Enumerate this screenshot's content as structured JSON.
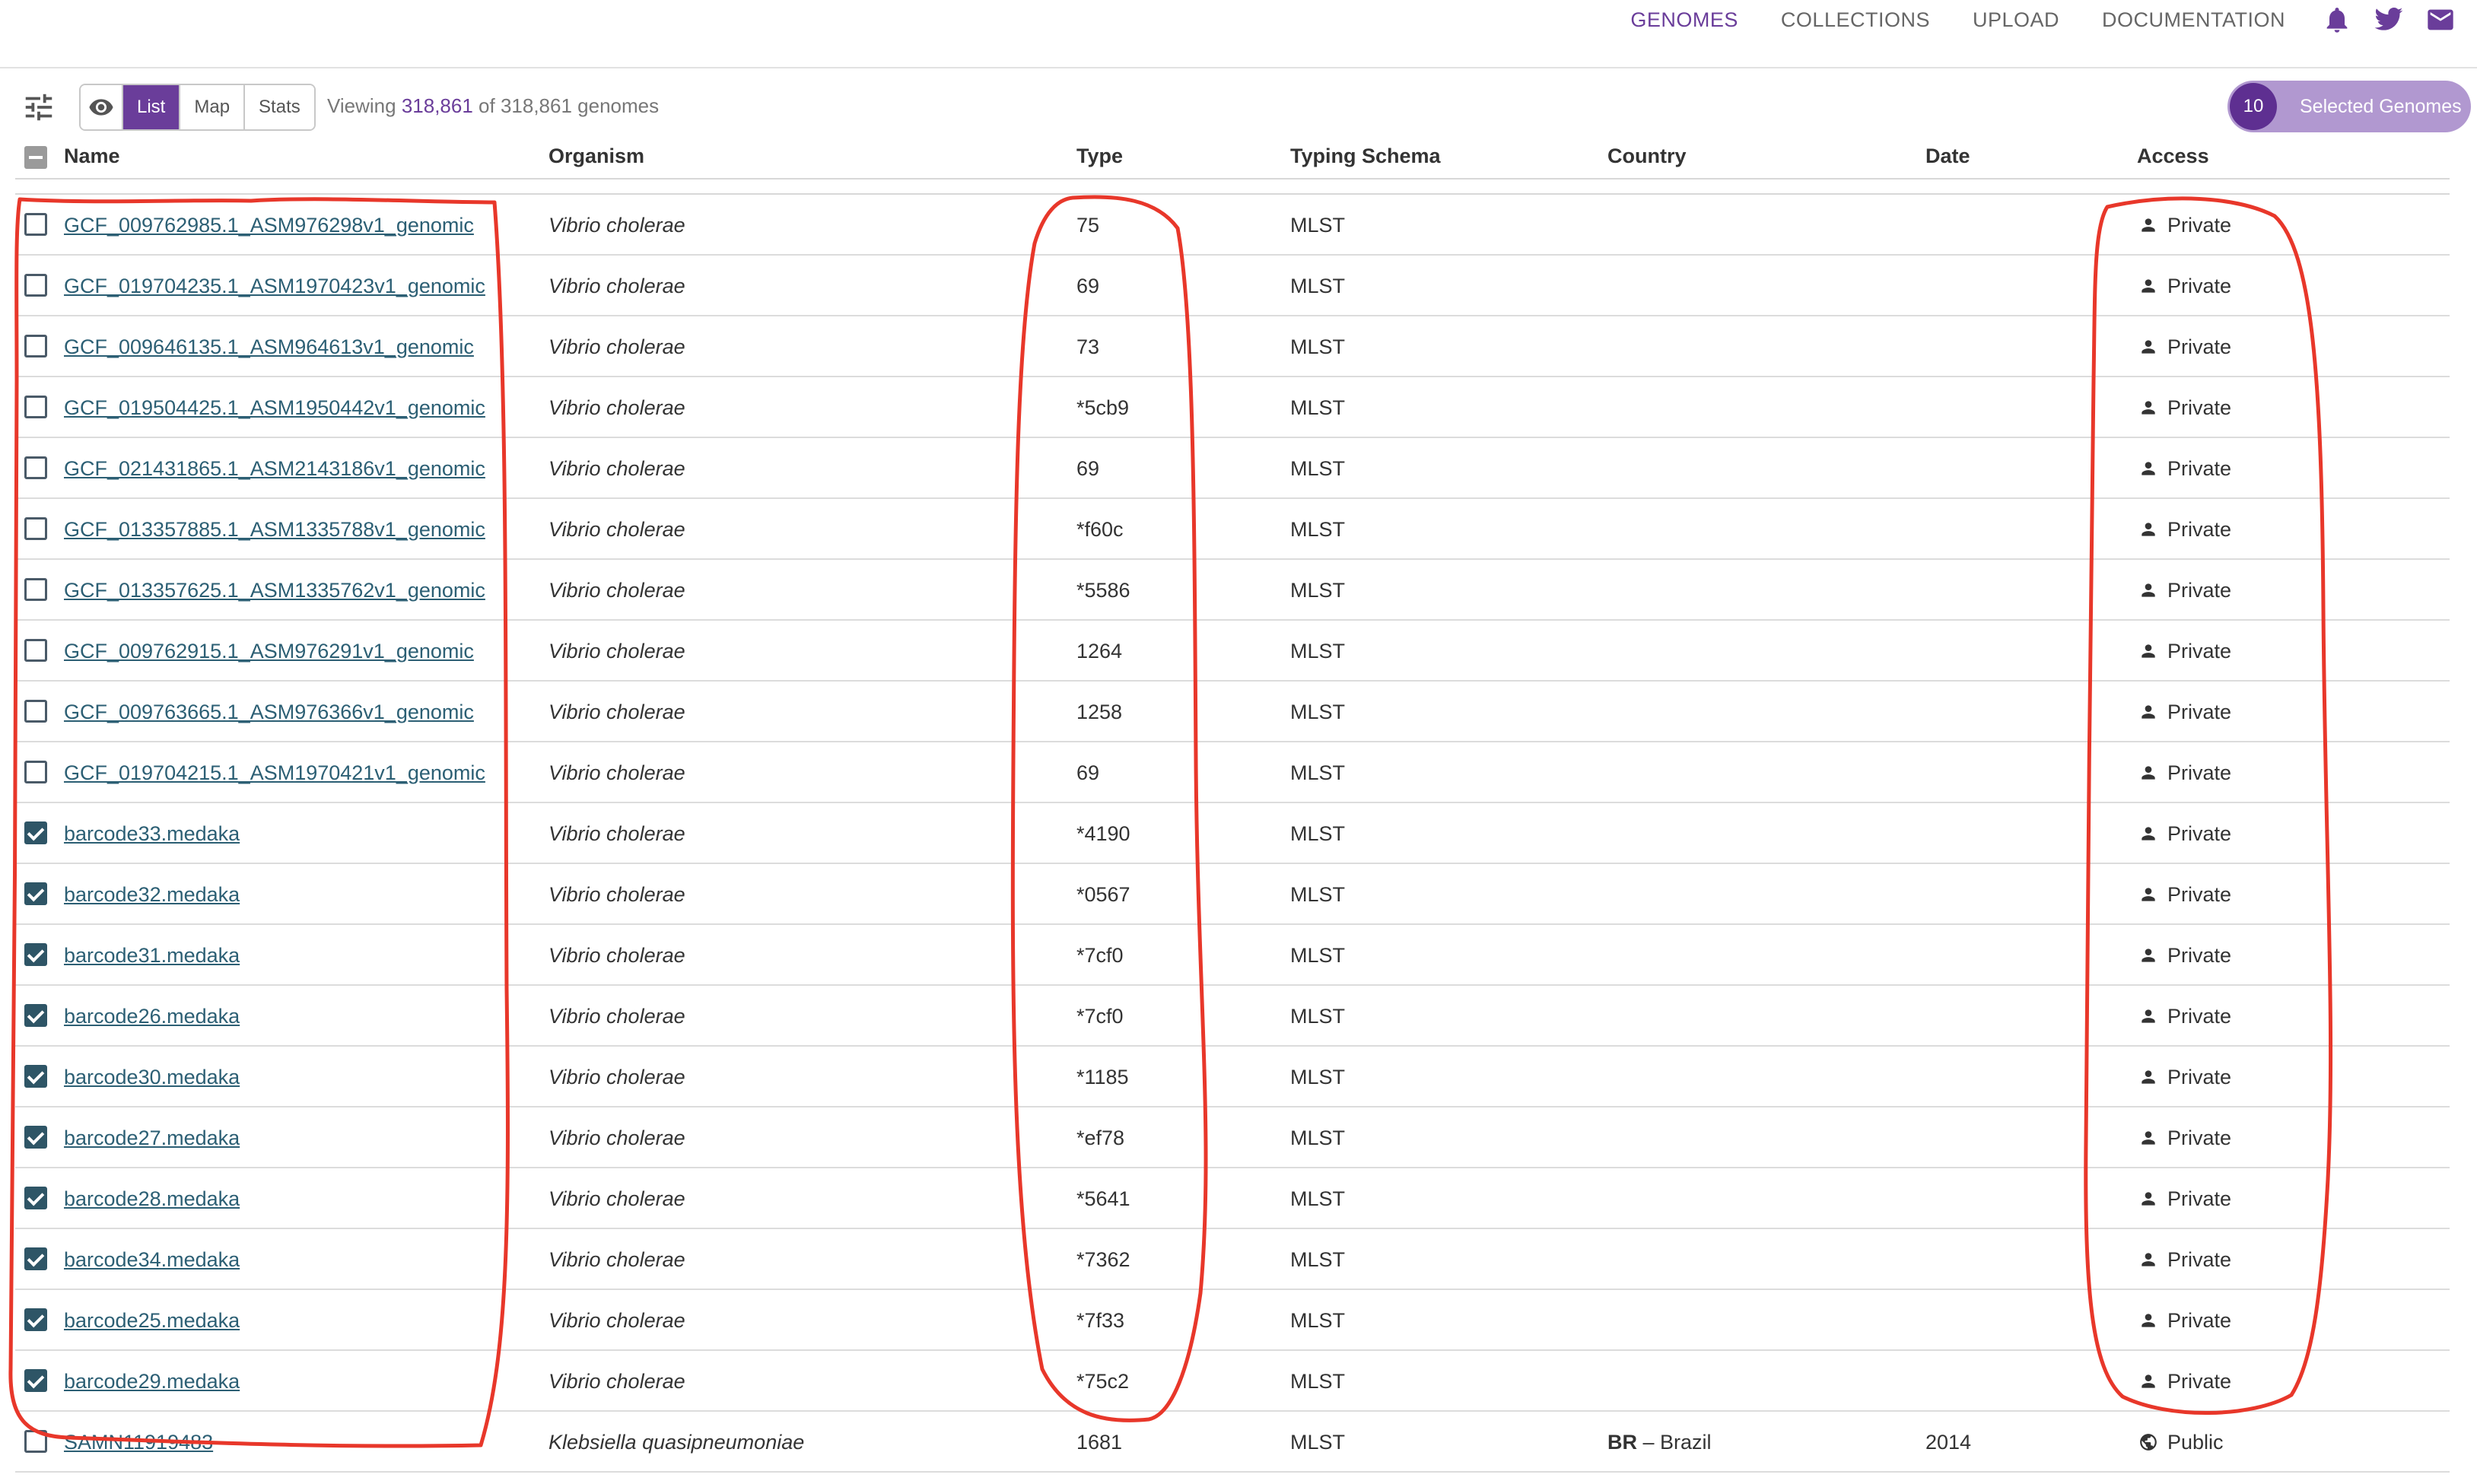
{
  "nav": {
    "links": [
      "GENOMES",
      "COLLECTIONS",
      "UPLOAD",
      "DOCUMENTATION"
    ],
    "icons": [
      "bell-icon",
      "twitter-icon",
      "mail-icon"
    ],
    "accent_color": "#6a3d9a"
  },
  "toolbar": {
    "views": [
      "List",
      "Map",
      "Stats"
    ],
    "active_view": "List",
    "viewing_prefix": "Viewing",
    "viewing_count": "318,861",
    "viewing_suffix": "of 318,861 genomes",
    "selected_count": "10",
    "selected_label": "Selected Genomes"
  },
  "table": {
    "headers": {
      "name": "Name",
      "organism": "Organism",
      "type": "Type",
      "typing_schema": "Typing Schema",
      "country": "Country",
      "date": "Date",
      "access": "Access"
    },
    "rows": [
      {
        "name": "GCF_009762985.1_ASM976298v1_genomic",
        "organism": "Vibrio cholerae",
        "type": "75",
        "schema": "MLST",
        "country_code": "",
        "country": "",
        "date": "",
        "access": "Private",
        "checked": false
      },
      {
        "name": "GCF_019704235.1_ASM1970423v1_genomic",
        "organism": "Vibrio cholerae",
        "type": "69",
        "schema": "MLST",
        "country_code": "",
        "country": "",
        "date": "",
        "access": "Private",
        "checked": false
      },
      {
        "name": "GCF_009646135.1_ASM964613v1_genomic",
        "organism": "Vibrio cholerae",
        "type": "73",
        "schema": "MLST",
        "country_code": "",
        "country": "",
        "date": "",
        "access": "Private",
        "checked": false
      },
      {
        "name": "GCF_019504425.1_ASM1950442v1_genomic",
        "organism": "Vibrio cholerae",
        "type": "*5cb9",
        "schema": "MLST",
        "country_code": "",
        "country": "",
        "date": "",
        "access": "Private",
        "checked": false
      },
      {
        "name": "GCF_021431865.1_ASM2143186v1_genomic",
        "organism": "Vibrio cholerae",
        "type": "69",
        "schema": "MLST",
        "country_code": "",
        "country": "",
        "date": "",
        "access": "Private",
        "checked": false
      },
      {
        "name": "GCF_013357885.1_ASM1335788v1_genomic",
        "organism": "Vibrio cholerae",
        "type": "*f60c",
        "schema": "MLST",
        "country_code": "",
        "country": "",
        "date": "",
        "access": "Private",
        "checked": false
      },
      {
        "name": "GCF_013357625.1_ASM1335762v1_genomic",
        "organism": "Vibrio cholerae",
        "type": "*5586",
        "schema": "MLST",
        "country_code": "",
        "country": "",
        "date": "",
        "access": "Private",
        "checked": false
      },
      {
        "name": "GCF_009762915.1_ASM976291v1_genomic",
        "organism": "Vibrio cholerae",
        "type": "1264",
        "schema": "MLST",
        "country_code": "",
        "country": "",
        "date": "",
        "access": "Private",
        "checked": false
      },
      {
        "name": "GCF_009763665.1_ASM976366v1_genomic",
        "organism": "Vibrio cholerae",
        "type": "1258",
        "schema": "MLST",
        "country_code": "",
        "country": "",
        "date": "",
        "access": "Private",
        "checked": false
      },
      {
        "name": "GCF_019704215.1_ASM1970421v1_genomic",
        "organism": "Vibrio cholerae",
        "type": "69",
        "schema": "MLST",
        "country_code": "",
        "country": "",
        "date": "",
        "access": "Private",
        "checked": false
      },
      {
        "name": "barcode33.medaka",
        "organism": "Vibrio cholerae",
        "type": "*4190",
        "schema": "MLST",
        "country_code": "",
        "country": "",
        "date": "",
        "access": "Private",
        "checked": true
      },
      {
        "name": "barcode32.medaka",
        "organism": "Vibrio cholerae",
        "type": "*0567",
        "schema": "MLST",
        "country_code": "",
        "country": "",
        "date": "",
        "access": "Private",
        "checked": true
      },
      {
        "name": "barcode31.medaka",
        "organism": "Vibrio cholerae",
        "type": "*7cf0",
        "schema": "MLST",
        "country_code": "",
        "country": "",
        "date": "",
        "access": "Private",
        "checked": true
      },
      {
        "name": "barcode26.medaka",
        "organism": "Vibrio cholerae",
        "type": "*7cf0",
        "schema": "MLST",
        "country_code": "",
        "country": "",
        "date": "",
        "access": "Private",
        "checked": true
      },
      {
        "name": "barcode30.medaka",
        "organism": "Vibrio cholerae",
        "type": "*1185",
        "schema": "MLST",
        "country_code": "",
        "country": "",
        "date": "",
        "access": "Private",
        "checked": true
      },
      {
        "name": "barcode27.medaka",
        "organism": "Vibrio cholerae",
        "type": "*ef78",
        "schema": "MLST",
        "country_code": "",
        "country": "",
        "date": "",
        "access": "Private",
        "checked": true
      },
      {
        "name": "barcode28.medaka",
        "organism": "Vibrio cholerae",
        "type": "*5641",
        "schema": "MLST",
        "country_code": "",
        "country": "",
        "date": "",
        "access": "Private",
        "checked": true
      },
      {
        "name": "barcode34.medaka",
        "organism": "Vibrio cholerae",
        "type": "*7362",
        "schema": "MLST",
        "country_code": "",
        "country": "",
        "date": "",
        "access": "Private",
        "checked": true
      },
      {
        "name": "barcode25.medaka",
        "organism": "Vibrio cholerae",
        "type": "*7f33",
        "schema": "MLST",
        "country_code": "",
        "country": "",
        "date": "",
        "access": "Private",
        "checked": true
      },
      {
        "name": "barcode29.medaka",
        "organism": "Vibrio cholerae",
        "type": "*75c2",
        "schema": "MLST",
        "country_code": "",
        "country": "",
        "date": "",
        "access": "Private",
        "checked": true
      },
      {
        "name": "SAMN11919483",
        "organism": "Klebsiella quasipneumoniae",
        "type": "1681",
        "schema": "MLST",
        "country_code": "BR",
        "country": "Brazil",
        "date": "2014",
        "access": "Public",
        "checked": false
      }
    ]
  },
  "annotation": {
    "color": "#e8372a",
    "outlined_columns": [
      "Name",
      "Type",
      "Access"
    ]
  }
}
